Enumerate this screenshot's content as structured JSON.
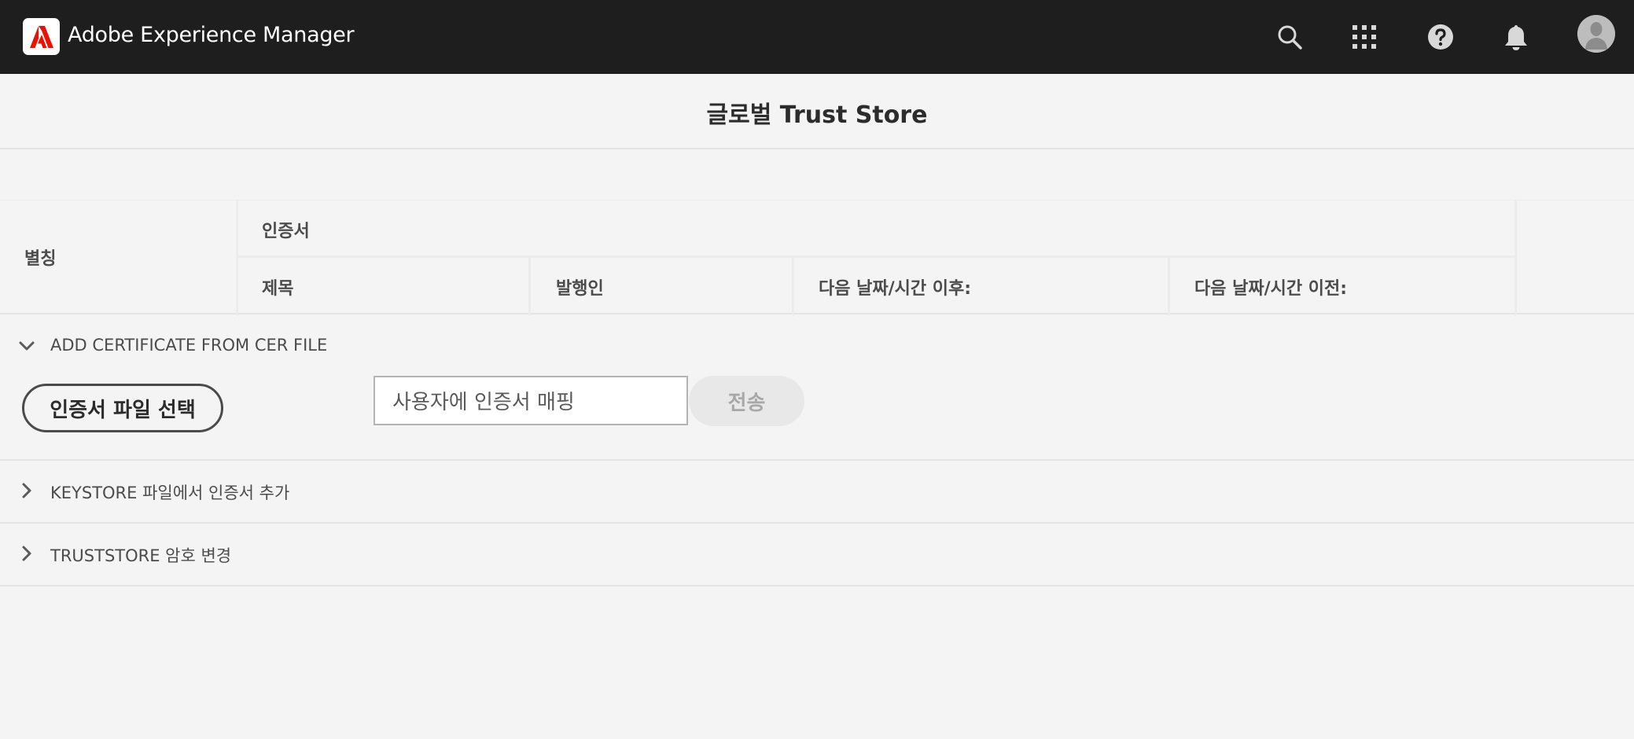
{
  "header": {
    "app_title": "Adobe Experience Manager",
    "icons": [
      "adobe-logo-icon",
      "search-icon",
      "apps-grid-icon",
      "help-icon",
      "bell-icon",
      "avatar-icon"
    ]
  },
  "page": {
    "title": "글로벌 Trust Store"
  },
  "table": {
    "alias_header": "별칭",
    "certificate_group_header": "인증서",
    "columns": [
      "제목",
      "발행인",
      "다음 날짜/시간 이후:",
      "다음 날짜/시간 이전:"
    ]
  },
  "sections": {
    "add_cer": {
      "title": "ADD CERTIFICATE FROM CER FILE",
      "expanded": true,
      "file_button": "인증서 파일 선택",
      "input_value": "사용자에 인증서 매핑",
      "submit_button": "전송"
    },
    "add_keystore": {
      "title": "KEYSTORE 파일에서 인증서 추가",
      "expanded": false
    },
    "change_password": {
      "title": "TRUSTSTORE 암호 변경",
      "expanded": false
    }
  },
  "colors": {
    "topbar": "#1e1e1e",
    "background": "#f4f4f4",
    "adobe_red": "#eb1000"
  }
}
